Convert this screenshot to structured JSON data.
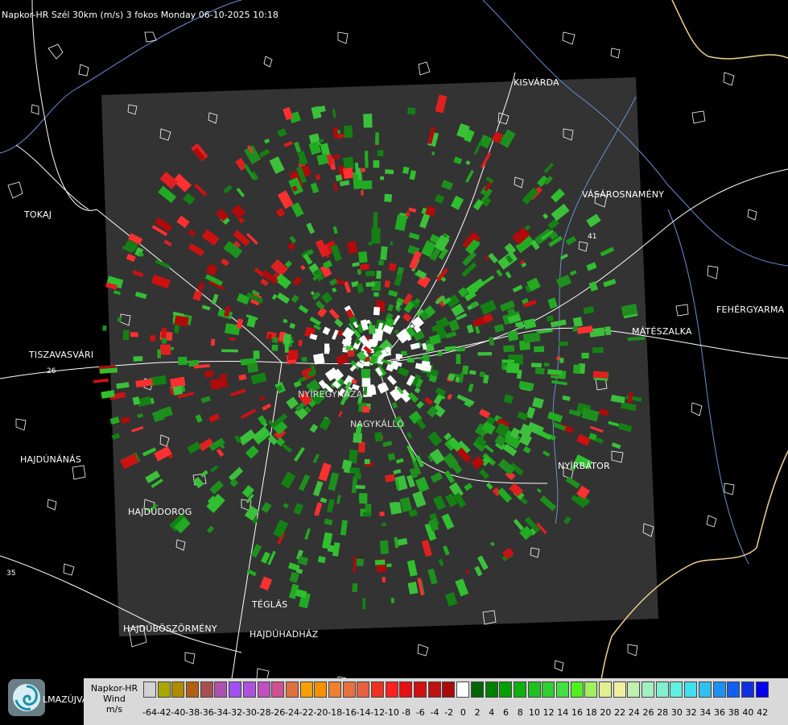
{
  "header": {
    "title": "Napkor-HR Szél 30km (m/s) 3 fokos Monday 06-10-2025 10:18"
  },
  "map": {
    "road_numbers": [
      "26",
      "41",
      "35"
    ],
    "cities": [
      {
        "id": "kisvarda",
        "name": "KISVÁRDA"
      },
      {
        "id": "tokaj",
        "name": "TOKAJ"
      },
      {
        "id": "vasarosnameny",
        "name": "VÁSÁROSNAMÉNY"
      },
      {
        "id": "fehergyarmat",
        "name": "FEHÉRGYARMA"
      },
      {
        "id": "mateszalka",
        "name": "MÁTÉSZALKA"
      },
      {
        "id": "tiszavasvari",
        "name": "TISZAVASVÁRI"
      },
      {
        "id": "nyiregyhaza",
        "name": "NYÍREGYHÁZA"
      },
      {
        "id": "nagykallo",
        "name": "NAGYKÁLLÓ"
      },
      {
        "id": "nyirbator",
        "name": "NYÍRBÁTOR"
      },
      {
        "id": "hajdunanas",
        "name": "HAJDÚNÁNÁS"
      },
      {
        "id": "hajdudorog",
        "name": "HAJDÚDOROG"
      },
      {
        "id": "teglas",
        "name": "TÉGLÁS"
      },
      {
        "id": "hajduboszormeny",
        "name": "HAJDÚBÖSZÖRMÉNY"
      },
      {
        "id": "hajduhadhaz",
        "name": "HAJDÚHADHÁZ"
      },
      {
        "id": "hajdusamson_partial",
        "name": "LMAZÚJVÁR"
      }
    ],
    "colors": {
      "background": "#000000",
      "radar_area": "#333333",
      "approaching": "#cc1111",
      "receding": "#22aa22"
    }
  },
  "legend": {
    "product": "Napkor-HR",
    "quantity": "Wind",
    "unit": "m/s",
    "ticks": [
      "-64",
      "-42",
      "-40",
      "-38",
      "-36",
      "-34",
      "-32",
      "-30",
      "-28",
      "-26",
      "-24",
      "-22",
      "-20",
      "-18",
      "-16",
      "-14",
      "-12",
      "-10",
      "-8",
      "-6",
      "-4",
      "-2",
      "0",
      "2",
      "4",
      "6",
      "8",
      "10",
      "12",
      "14",
      "16",
      "18",
      "20",
      "22",
      "24",
      "26",
      "28",
      "30",
      "32",
      "34",
      "36",
      "38",
      "40",
      "42"
    ],
    "colors": [
      "#d3d3d3",
      "#a8a800",
      "#b08a00",
      "#b06010",
      "#a85050",
      "#b050b0",
      "#a050f0",
      "#b050e0",
      "#c050c0",
      "#d05090",
      "#e07040",
      "#f8a000",
      "#f89000",
      "#f08030",
      "#e87040",
      "#e86040",
      "#f03020",
      "#ff2020",
      "#e81010",
      "#d01010",
      "#c01010",
      "#aa0a0a",
      "#ffffff",
      "#006400",
      "#008000",
      "#00a000",
      "#10b010",
      "#20c020",
      "#30d030",
      "#40e040",
      "#50f020",
      "#a0f060",
      "#e0f090",
      "#f0f0a0",
      "#c0f0b0",
      "#a0f0c0",
      "#80f0d0",
      "#60f0e0",
      "#40e0f0",
      "#30c0f0",
      "#2090f0",
      "#1060f0",
      "#1030e0",
      "#0000f0"
    ]
  },
  "logo": {
    "icon": "swirl-logo-icon"
  }
}
